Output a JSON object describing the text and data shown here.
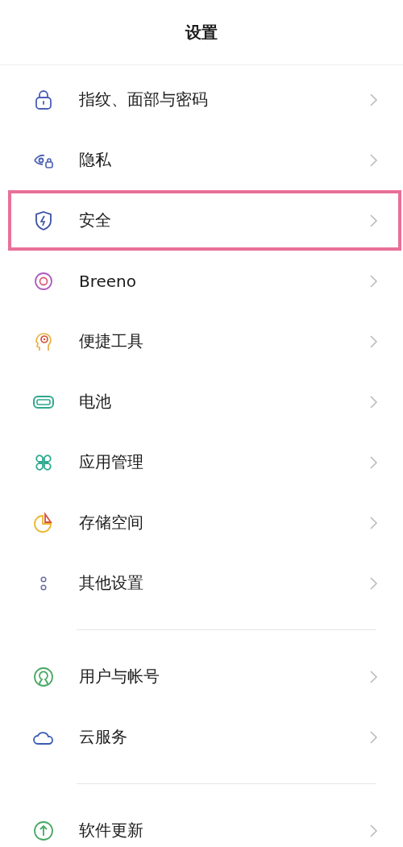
{
  "title": "设置",
  "groups": [
    {
      "items": [
        {
          "kind": "lock",
          "label": "指纹、面部与密码",
          "highlighted": false
        },
        {
          "kind": "privacy",
          "label": "隐私",
          "highlighted": false
        },
        {
          "kind": "shield",
          "label": "安全",
          "highlighted": true
        },
        {
          "kind": "ring",
          "label": "Breeno",
          "highlighted": false
        },
        {
          "kind": "head",
          "label": "便捷工具",
          "highlighted": false
        },
        {
          "kind": "battery",
          "label": "电池",
          "highlighted": false
        },
        {
          "kind": "apps",
          "label": "应用管理",
          "highlighted": false
        },
        {
          "kind": "pie",
          "label": "存储空间",
          "highlighted": false
        },
        {
          "kind": "dots",
          "label": "其他设置",
          "highlighted": false
        }
      ]
    },
    {
      "items": [
        {
          "kind": "user",
          "label": "用户与帐号",
          "highlighted": false
        },
        {
          "kind": "cloud",
          "label": "云服务",
          "highlighted": false
        }
      ]
    },
    {
      "items": [
        {
          "kind": "update",
          "label": "软件更新",
          "highlighted": false
        }
      ]
    }
  ]
}
